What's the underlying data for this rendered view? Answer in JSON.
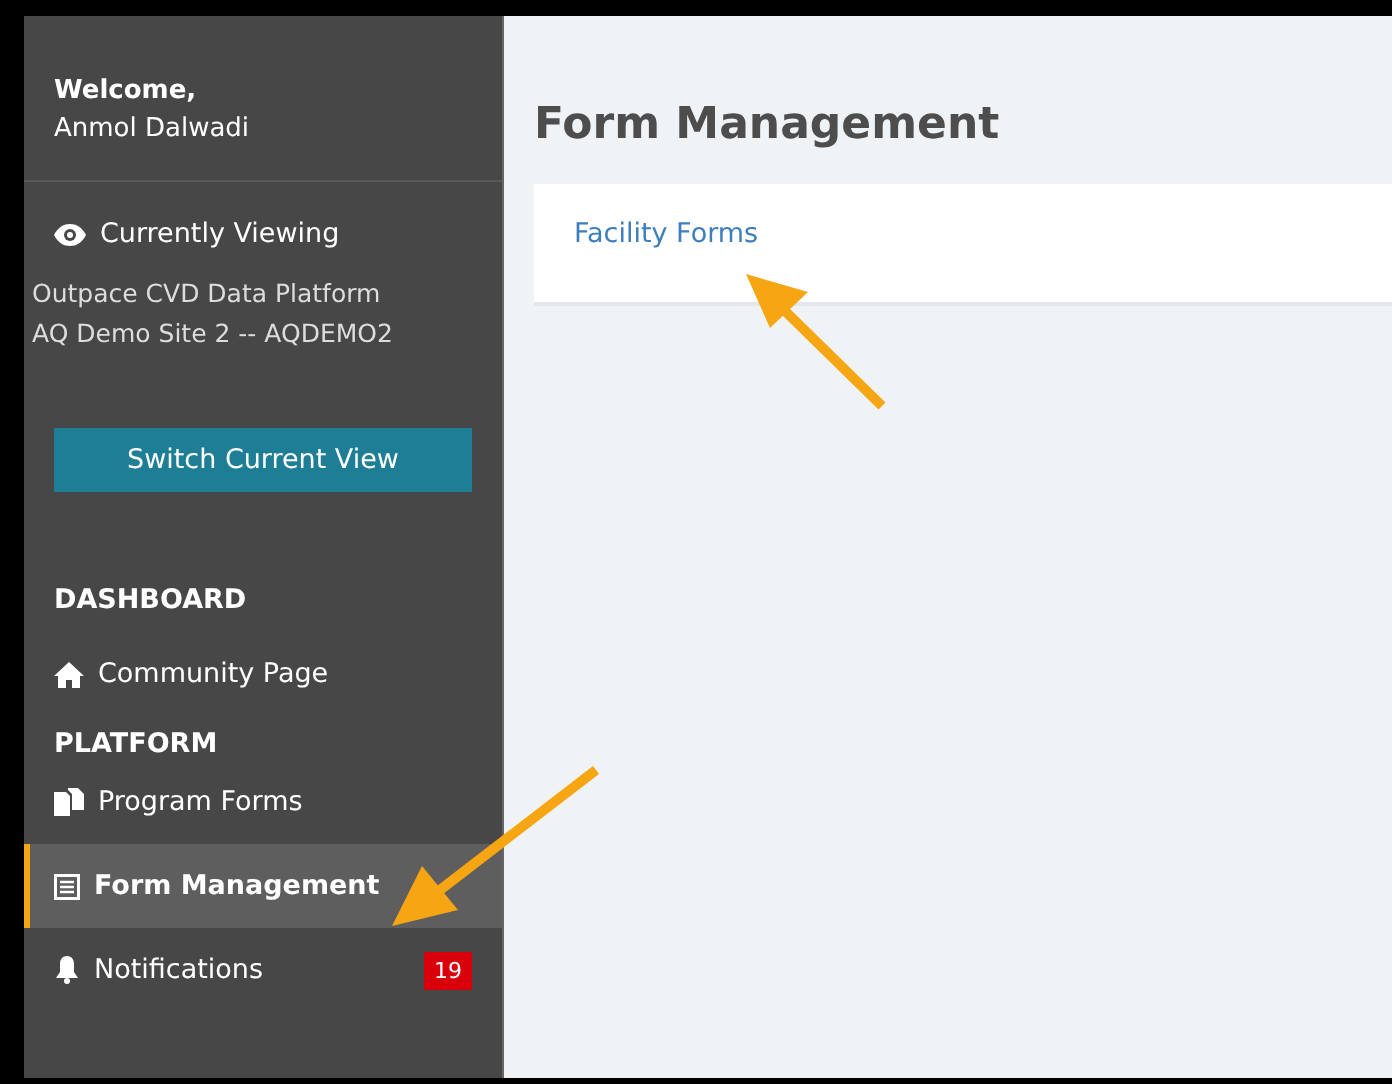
{
  "sidebar": {
    "welcome": "Welcome,",
    "user": "Anmol Dalwadi",
    "viewing_label": "Currently Viewing",
    "platform": "Outpace CVD Data Platform",
    "site": "AQ Demo Site 2 -- AQDEMO2",
    "switch_button": "Switch Current View",
    "items": [
      {
        "kind": "section",
        "label": "DASHBOARD"
      },
      {
        "kind": "link",
        "label": "Community Page",
        "selected": false
      },
      {
        "kind": "section",
        "label": "PLATFORM"
      },
      {
        "kind": "link",
        "label": "Program Forms",
        "selected": false
      },
      {
        "kind": "link",
        "label": "Form Management",
        "selected": true
      },
      {
        "kind": "link",
        "label": "Notifications",
        "selected": false,
        "badge": "19"
      }
    ]
  },
  "main": {
    "title": "Form Management",
    "links": [
      "Facility Forms"
    ]
  }
}
